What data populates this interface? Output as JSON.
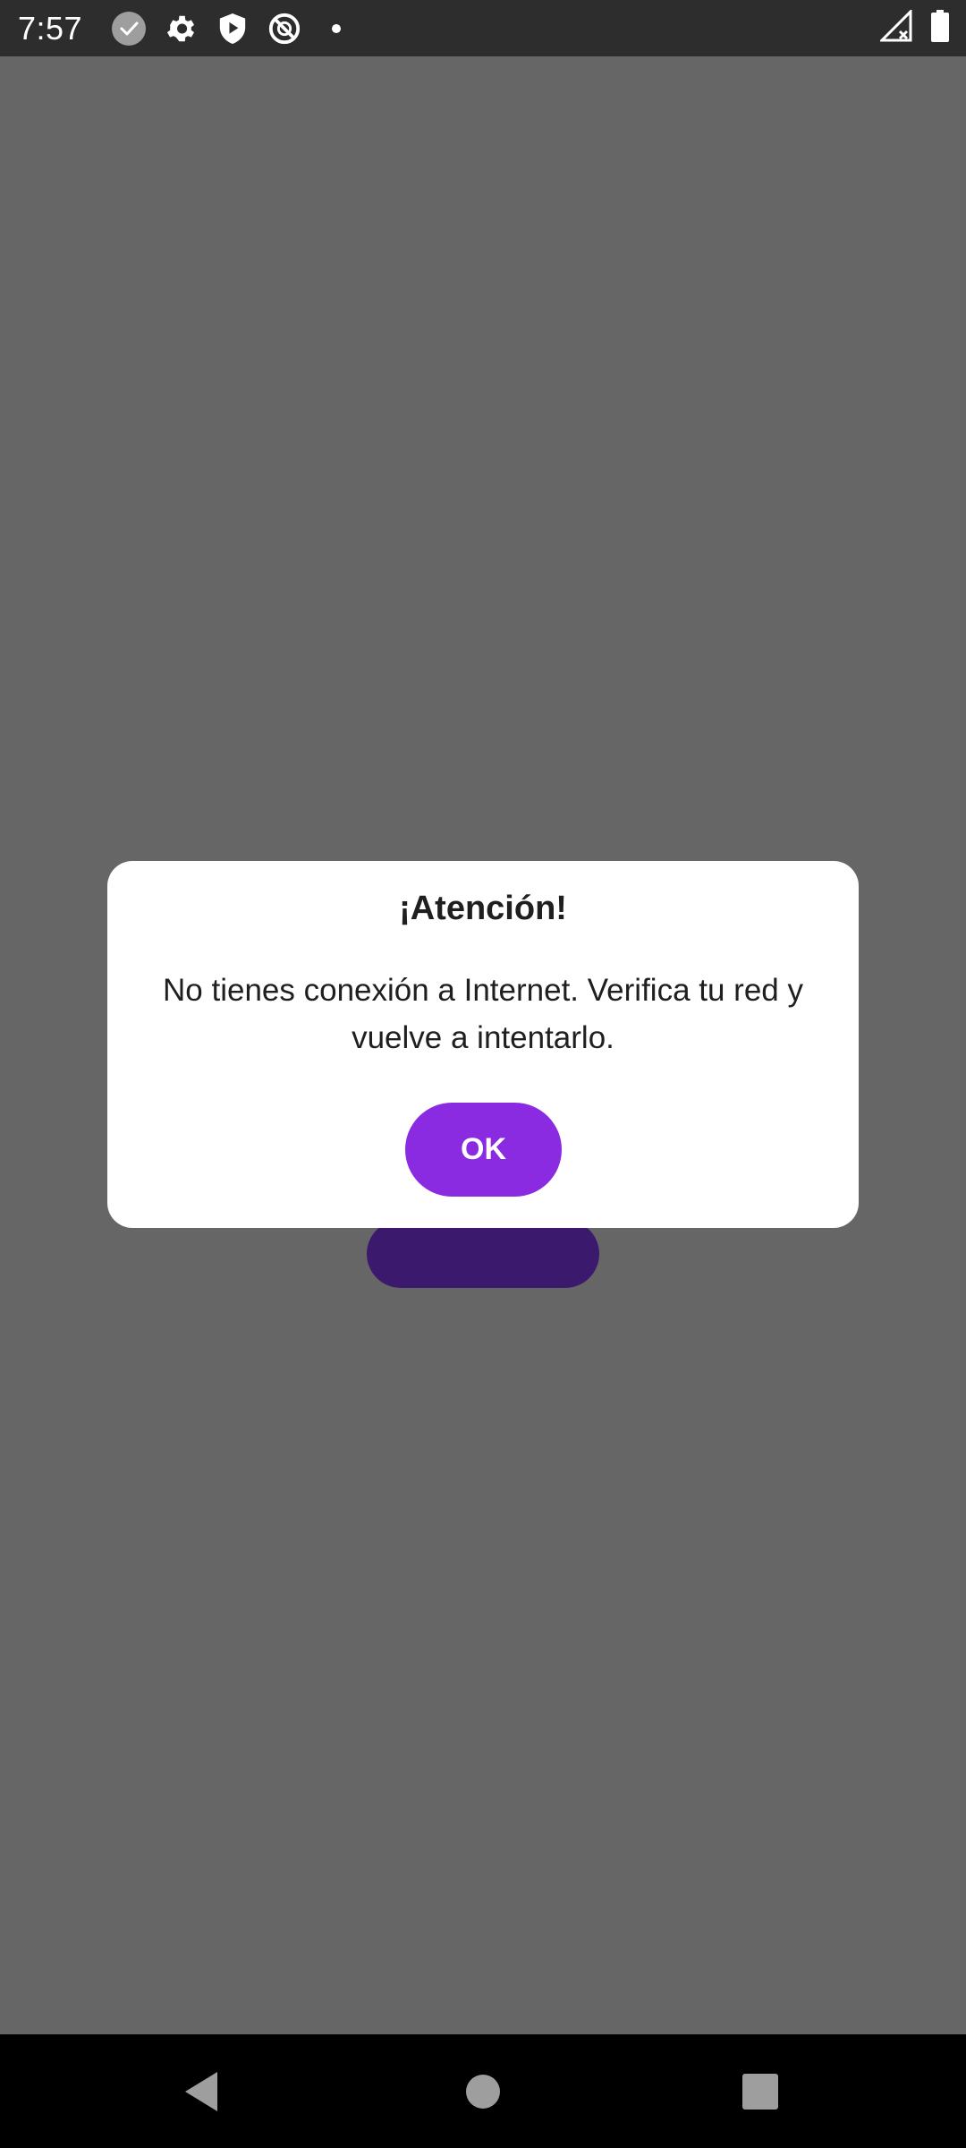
{
  "status_bar": {
    "time": "7:57",
    "left_icons": [
      "check-circle-icon",
      "gear-icon",
      "shield-play-icon",
      "circle-slash-icon",
      "dot-icon"
    ],
    "right_icons": [
      "signal-no-connection-icon",
      "battery-icon"
    ]
  },
  "dialog": {
    "title": "¡Atención!",
    "message": "No tienes conexión a Internet. Verifica tu red y vuelve a intentarlo.",
    "ok_label": "OK"
  },
  "nav_bar": {
    "icons": [
      "back-icon",
      "home-icon",
      "recents-icon"
    ]
  },
  "colors": {
    "accent": "#8a2be2",
    "scrim": "#666666",
    "status_bar": "#2d2d2d",
    "nav_bar": "#000000"
  }
}
